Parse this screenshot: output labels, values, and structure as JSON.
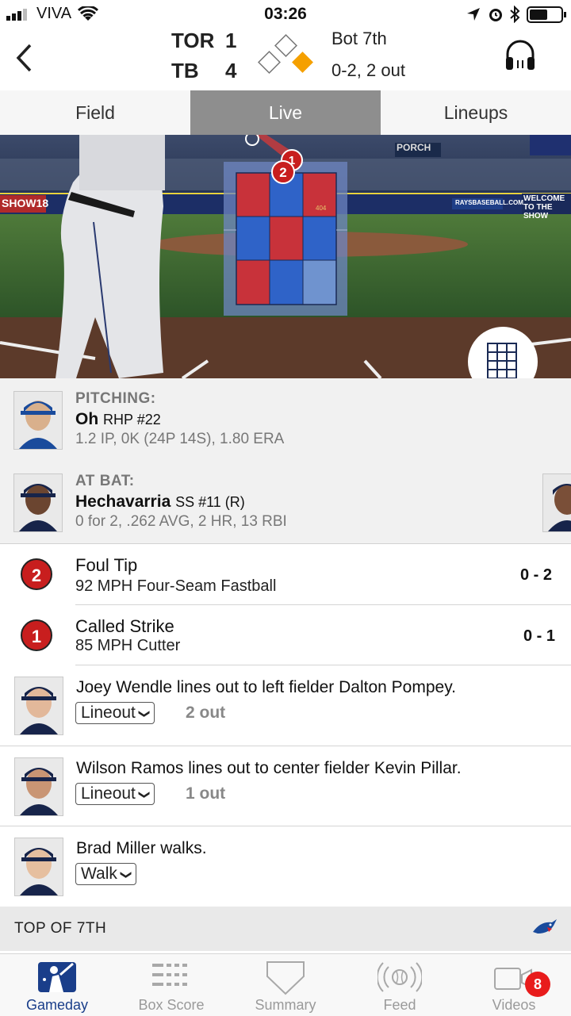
{
  "status": {
    "carrier": "VIVA",
    "time": "03:26"
  },
  "game": {
    "away": {
      "abbr": "TOR",
      "score": "1"
    },
    "home": {
      "abbr": "TB",
      "score": "4"
    },
    "inning": "Bot 7th",
    "count_outs": "0-2, 2 out"
  },
  "tabs": [
    "Field",
    "Live",
    "Lineups"
  ],
  "field_ad": {
    "porch": "PORCH",
    "show": "SHOW18",
    "welcome": "WELCOME TO THE SHOW",
    "rays": "RAYSBASEBALL.COM",
    "distance": "404"
  },
  "pitching": {
    "label": "PITCHING:",
    "name": "Oh",
    "detail": "RHP #22",
    "stats": "1.2 IP, 0K (24P 14S), 1.80 ERA"
  },
  "at_bat": {
    "label": "AT BAT:",
    "name": "Hechavarria",
    "detail": "SS #11 (R)",
    "stats": "0 for 2, .262 AVG, 2 HR, 13 RBI"
  },
  "pitches": [
    {
      "num": "2",
      "title": "Foul Tip",
      "desc": "92 MPH Four-Seam Fastball",
      "count": "0 - 2"
    },
    {
      "num": "1",
      "title": "Called Strike",
      "desc": "85 MPH Cutter",
      "count": "0 - 1"
    }
  ],
  "plays": [
    {
      "text": "Joey Wendle lines out to left fielder Dalton Pompey.",
      "tag": "Lineout",
      "outs": "2 out"
    },
    {
      "text": "Wilson Ramos lines out to center fielder Kevin Pillar.",
      "tag": "Lineout",
      "outs": "1 out"
    },
    {
      "text": "Brad Miller walks.",
      "tag": "Walk",
      "outs": ""
    }
  ],
  "inning_header": "TOP OF 7TH",
  "nav": [
    {
      "label": "Gameday",
      "icon": "batter-icon"
    },
    {
      "label": "Box Score",
      "icon": "boxscore-icon"
    },
    {
      "label": "Summary",
      "icon": "home-plate-icon"
    },
    {
      "label": "Feed",
      "icon": "feed-icon"
    },
    {
      "label": "Videos",
      "icon": "video-icon",
      "badge": "8"
    }
  ],
  "colors": {
    "strike_red": "#c81e1e",
    "zone_blue": "#2f63c8",
    "base_yellow": "#f5a000",
    "nav_active": "#1a3e8a"
  }
}
